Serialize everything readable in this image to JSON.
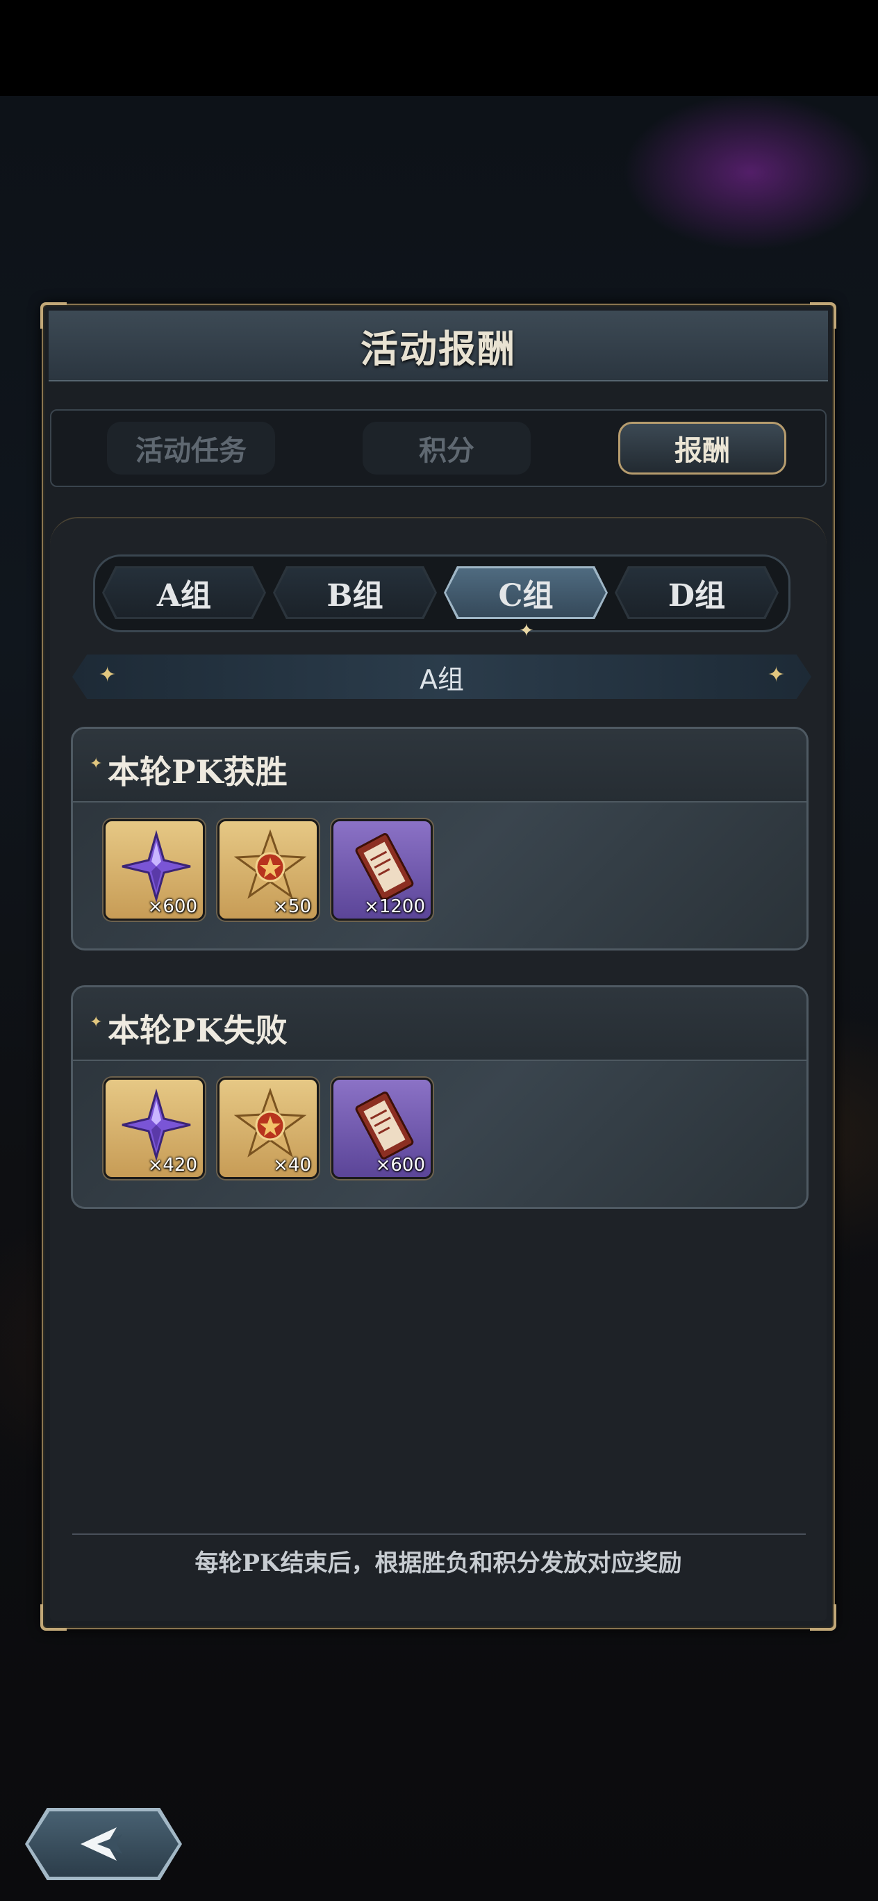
{
  "header": {
    "title": "活动报酬"
  },
  "tabs": [
    {
      "label": "活动任务",
      "active": false
    },
    {
      "label": "积分",
      "active": false
    },
    {
      "label": "报酬",
      "active": true
    }
  ],
  "groups": [
    {
      "label": "A组",
      "active": false
    },
    {
      "label": "B组",
      "active": false
    },
    {
      "label": "C组",
      "active": true
    },
    {
      "label": "D组",
      "active": false
    }
  ],
  "section_label": "A组",
  "reward_sections": [
    {
      "title": "本轮PK获胜",
      "items": [
        {
          "icon": "purple-crystal-icon",
          "qty": "×600",
          "rarity": "gold"
        },
        {
          "icon": "red-star-emblem-icon",
          "qty": "×50",
          "rarity": "gold"
        },
        {
          "icon": "ticket-scroll-icon",
          "qty": "×1200",
          "rarity": "purple"
        }
      ]
    },
    {
      "title": "本轮PK失败",
      "items": [
        {
          "icon": "purple-crystal-icon",
          "qty": "×420",
          "rarity": "gold"
        },
        {
          "icon": "red-star-emblem-icon",
          "qty": "×40",
          "rarity": "gold"
        },
        {
          "icon": "ticket-scroll-icon",
          "qty": "×600",
          "rarity": "purple"
        }
      ]
    }
  ],
  "footer_note": "每轮PK结束后，根据胜负和积分发放对应奖励",
  "colors": {
    "frame_gold": "#8a7550",
    "accent_gold": "#e2c77f",
    "active_blue": "#4f6b80"
  }
}
